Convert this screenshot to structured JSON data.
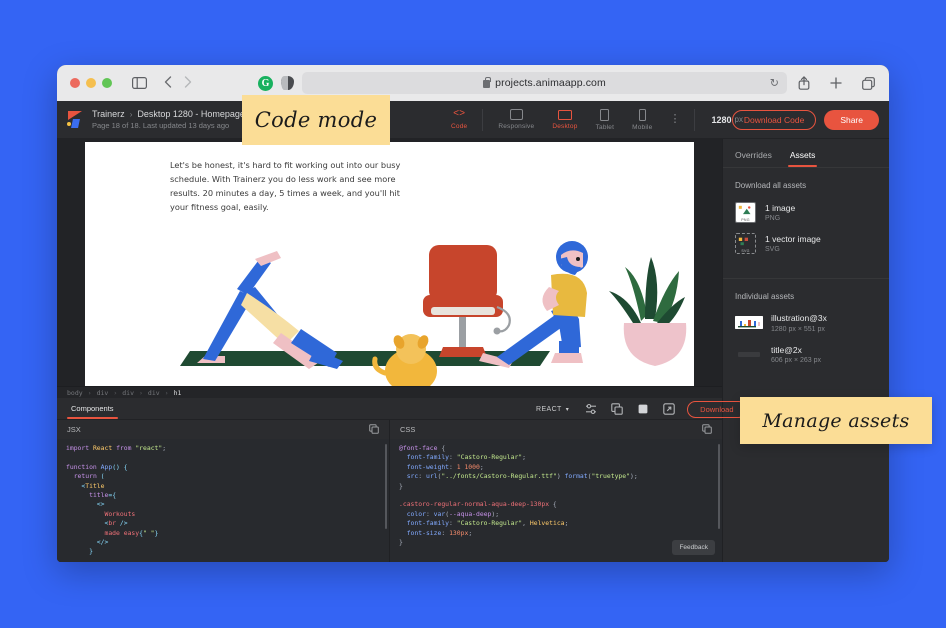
{
  "browser": {
    "url": "projects.animaapp.com",
    "icons": {
      "sidebar": "sidebar-toggle-icon",
      "back": "back-arrow-icon",
      "forward": "forward-arrow-icon",
      "grammarly": "G",
      "shield": "shield-extension-icon",
      "lock": "lock-icon",
      "reload": "↻",
      "share": "share-icon",
      "newtab": "+",
      "tabs": "tabs-icon"
    }
  },
  "app_header": {
    "project": "Trainerz",
    "page": "Desktop 1280 - Homepage",
    "caret": "⌄",
    "separator": "›",
    "subtitle": "Page 18 of 18. Last updated 13 days ago",
    "mode_button": {
      "label": "Code",
      "glyph": "<>"
    },
    "devices": [
      {
        "label": "Responsive",
        "active": false
      },
      {
        "label": "Desktop",
        "active": true
      },
      {
        "label": "Tablet",
        "active": false
      },
      {
        "label": "Mobile",
        "active": false
      }
    ],
    "more": "⋮",
    "zoom_value": "1280",
    "zoom_unit": "px",
    "download_code_label": "Download Code",
    "share_label": "Share"
  },
  "canvas": {
    "paragraph": "Let's be honest, it's hard to fit working out into our busy schedule. With Trainerz you do less work and see more results. 20 minutes a day, 5 times a week, and you'll hit your fitness goal, easily."
  },
  "right_panel": {
    "tabs": [
      {
        "label": "Overrides",
        "active": false
      },
      {
        "label": "Assets",
        "active": true
      }
    ],
    "download_all_heading": "Download all assets",
    "bundles": [
      {
        "name": "1 image",
        "format": "PNG",
        "tag": "PNG"
      },
      {
        "name": "1 vector image",
        "format": "SVG",
        "tag": "SVG"
      }
    ],
    "individual_heading": "Individual assets",
    "assets": [
      {
        "name": "illustration@3x",
        "dims": "1280 px × 551 px"
      },
      {
        "name": "title@2x",
        "dims": "606 px × 263 px"
      }
    ]
  },
  "dom_breadcrumb": {
    "items": [
      "body",
      "div",
      "div",
      "div"
    ],
    "current": "h1",
    "separator": "›"
  },
  "editor": {
    "tab_label": "Components",
    "framework": "REACT",
    "framework_caret": "▾",
    "icons": [
      "settings-sliders-icon",
      "copy-frame-icon",
      "stop-square-icon",
      "open-external-icon"
    ],
    "download_label": "Download",
    "expand_caret": "⌄",
    "panes": [
      {
        "lang": "JSX",
        "copy_icon": "copy-icon"
      },
      {
        "lang": "CSS",
        "copy_icon": "copy-icon"
      }
    ],
    "feedback_label": "Feedback"
  },
  "code": {
    "jsx_lines": [
      "import React from \"react\";",
      "",
      "function App() {",
      "  return (",
      "    <Title",
      "      title={",
      "        <>",
      "          Workouts",
      "          <br />",
      "          made easy{\" \"}",
      "        </>",
      "      }"
    ],
    "css_lines": [
      "@font-face {",
      "  font-family: \"Castoro-Regular\";",
      "  font-weight: 1 1000;",
      "  src: url(\"../fonts/Castoro-Regular.ttf\") format(\"truetype\");",
      "}",
      "",
      ".castoro-regular-normal-aqua-deep-130px {",
      "  color: var(--aqua-deep);",
      "  font-family: \"Castoro-Regular\", Helvetica;",
      "  font-size: 130px;",
      "}"
    ]
  },
  "annotations": [
    {
      "text": "Code mode"
    },
    {
      "text": "Manage assets"
    }
  ],
  "colors": {
    "background": "#3464f4",
    "accent": "#e8543f",
    "sticky": "#fbdd96",
    "panel": "#2b2c2f",
    "code_bg": "#282a2e"
  }
}
